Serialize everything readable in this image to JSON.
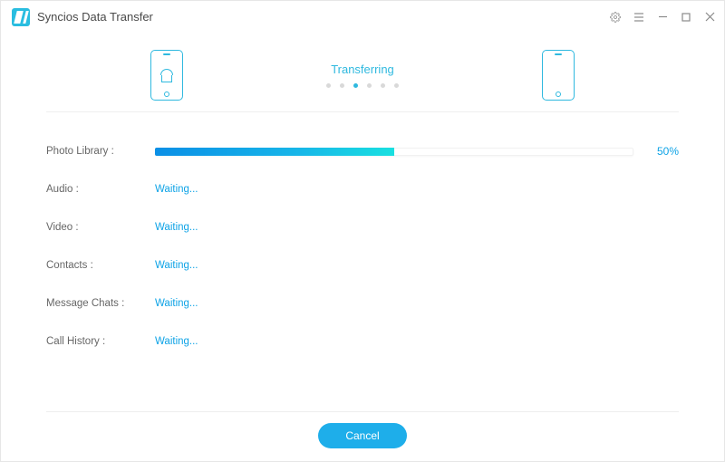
{
  "app": {
    "title": "Syncios Data Transfer"
  },
  "header": {
    "status_label": "Transferring",
    "dots_total": 6,
    "dots_active_index": 2,
    "source_device": "android",
    "target_device": "apple"
  },
  "items": [
    {
      "label": "Photo Library :",
      "state": "progress",
      "percent": 50,
      "percent_label": "50%"
    },
    {
      "label": "Audio :",
      "state": "waiting",
      "status_text": "Waiting..."
    },
    {
      "label": "Video :",
      "state": "waiting",
      "status_text": "Waiting..."
    },
    {
      "label": "Contacts :",
      "state": "waiting",
      "status_text": "Waiting..."
    },
    {
      "label": "Message Chats :",
      "state": "waiting",
      "status_text": "Waiting..."
    },
    {
      "label": "Call History :",
      "state": "waiting",
      "status_text": "Waiting..."
    }
  ],
  "footer": {
    "cancel_label": "Cancel"
  },
  "colors": {
    "accent": "#1eaeea",
    "link": "#0ea3e6"
  }
}
